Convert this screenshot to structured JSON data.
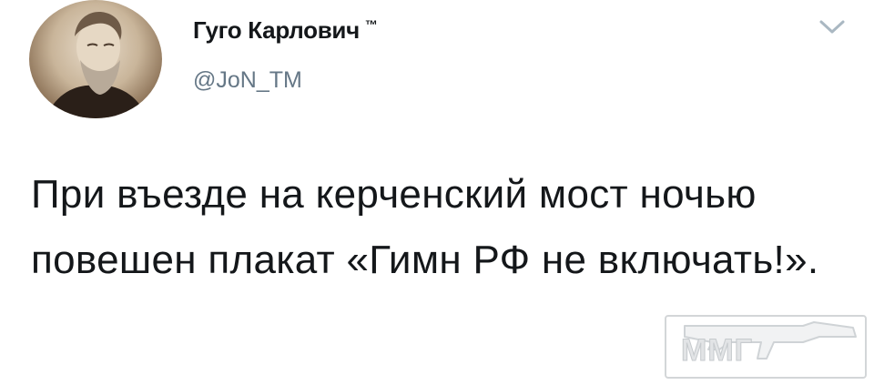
{
  "tweet": {
    "author_name": "Гуго Карлович",
    "trademark": "™",
    "handle": "@JoN_TM",
    "text": "При въезде на керченский мост ночью повешен плакат «Гимн РФ не включать!»."
  },
  "icons": {
    "avatar": "portrait-avatar",
    "menu": "chevron-down-icon"
  },
  "watermark": {
    "text": "ММГ"
  },
  "colors": {
    "text": "#14171a",
    "secondary": "#657786",
    "chevron": "#aab8c2"
  }
}
